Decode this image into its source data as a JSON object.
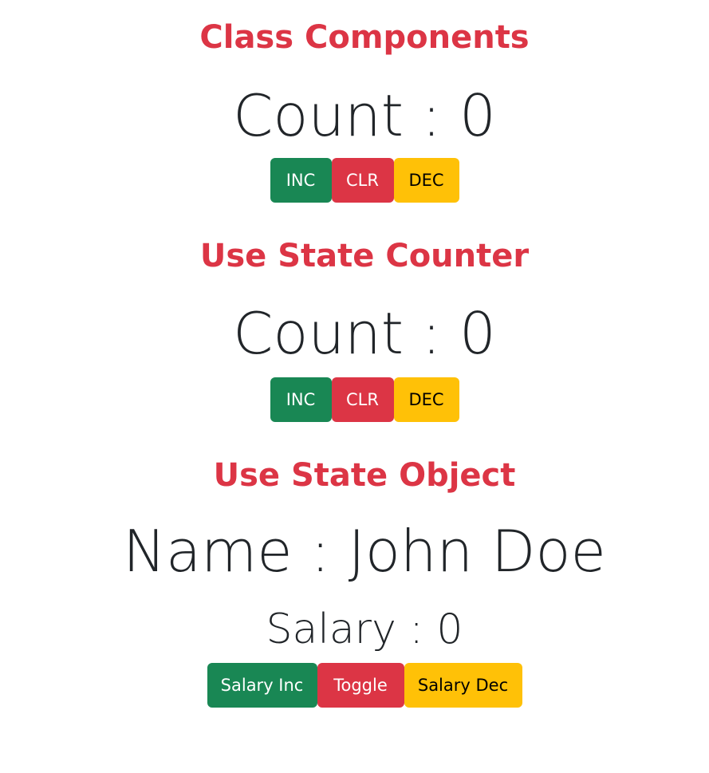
{
  "class_section": {
    "title": "Class Components",
    "count_label": "Count : 0",
    "buttons": {
      "inc": "INC",
      "clr": "CLR",
      "dec": "DEC"
    }
  },
  "state_counter_section": {
    "title": "Use State Counter",
    "count_label": "Count : 0",
    "buttons": {
      "inc": "INC",
      "clr": "CLR",
      "dec": "DEC"
    }
  },
  "state_object_section": {
    "title": "Use State Object",
    "name_label": "Name : John Doe",
    "salary_label": "Salary : 0",
    "buttons": {
      "salary_inc": "Salary Inc",
      "toggle": "Toggle",
      "salary_dec": "Salary Dec"
    }
  },
  "colors": {
    "heading": "#dc3545",
    "success": "#198754",
    "danger": "#dc3545",
    "warning": "#ffc107",
    "text": "#212529"
  }
}
